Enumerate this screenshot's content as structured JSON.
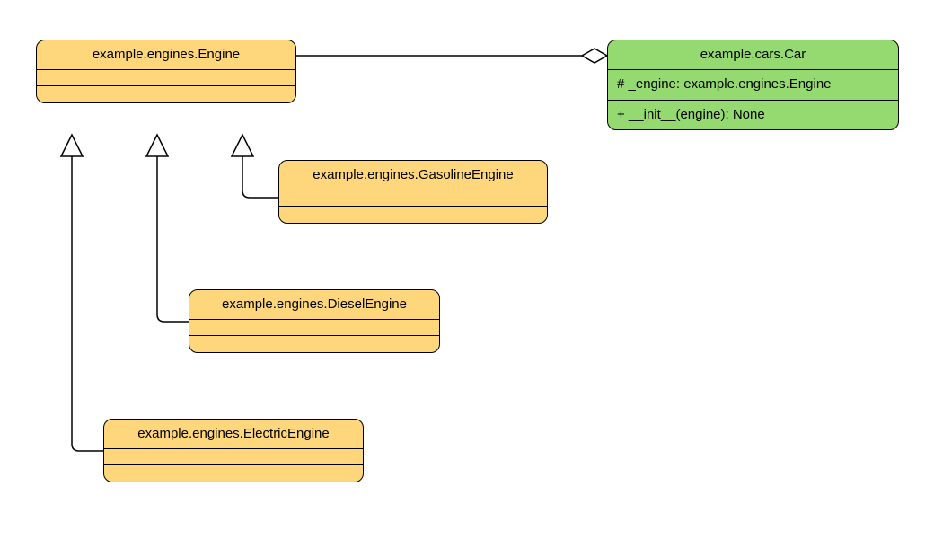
{
  "colors": {
    "engine_fill": "#fed77c",
    "car_fill": "#95d971",
    "stroke": "#000000"
  },
  "classes": {
    "engine": {
      "title": "example.engines.Engine",
      "attributes": [],
      "operations": []
    },
    "gasoline": {
      "title": "example.engines.GasolineEngine",
      "attributes": [],
      "operations": []
    },
    "diesel": {
      "title": "example.engines.DieselEngine",
      "attributes": [],
      "operations": []
    },
    "electric": {
      "title": "example.engines.ElectricEngine",
      "attributes": [],
      "operations": []
    },
    "car": {
      "title": "example.cars.Car",
      "attributes": [
        "# _engine: example.engines.Engine"
      ],
      "operations": [
        "+ __init__(engine): None"
      ]
    }
  },
  "relationships": [
    {
      "type": "generalization",
      "child": "gasoline",
      "parent": "engine"
    },
    {
      "type": "generalization",
      "child": "diesel",
      "parent": "engine"
    },
    {
      "type": "generalization",
      "child": "electric",
      "parent": "engine"
    },
    {
      "type": "aggregation",
      "whole": "car",
      "part": "engine"
    }
  ]
}
